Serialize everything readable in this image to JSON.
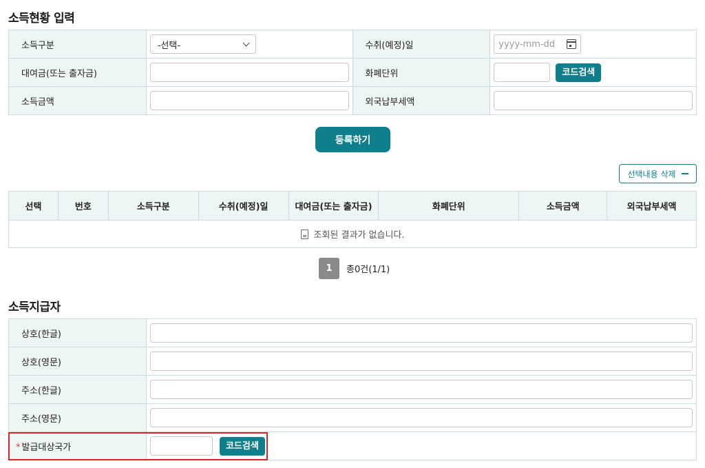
{
  "section1": {
    "title": "소득현황 입력",
    "rows": {
      "income_type_label": "소득구분",
      "income_type_value": "-선택-",
      "receipt_date_label": "수취(예정)일",
      "receipt_date_placeholder": "yyyy-mm-dd",
      "loan_label": "대여금(또는 출자금)",
      "currency_label": "화폐단위",
      "code_search_label": "코드검색",
      "income_amount_label": "소득금액",
      "foreign_tax_label": "외국납부세액"
    },
    "register_button": "등록하기",
    "delete_selected_button": "선택내용 삭제"
  },
  "list": {
    "headers": [
      "선택",
      "번호",
      "소득구분",
      "수취(예정)일",
      "대여금(또는 출자금)",
      "화폐단위",
      "소득금액",
      "외국납부세액"
    ],
    "empty_message": "조회된 결과가 없습니다.",
    "page": "1",
    "total": "총0건(1/1)"
  },
  "section2": {
    "title": "소득지급자",
    "rows": {
      "name_kor_label": "상호(한글)",
      "name_eng_label": "상호(영문)",
      "addr_kor_label": "주소(한글)",
      "addr_eng_label": "주소(영문)",
      "required_mark": "*",
      "country_label": "발급대상국가",
      "code_search_label": "코드검색"
    }
  },
  "colors": {
    "accent": "#0f7f8c",
    "label_bg": "#eef6f5",
    "border": "#c9dde0",
    "highlight": "#e02424"
  }
}
